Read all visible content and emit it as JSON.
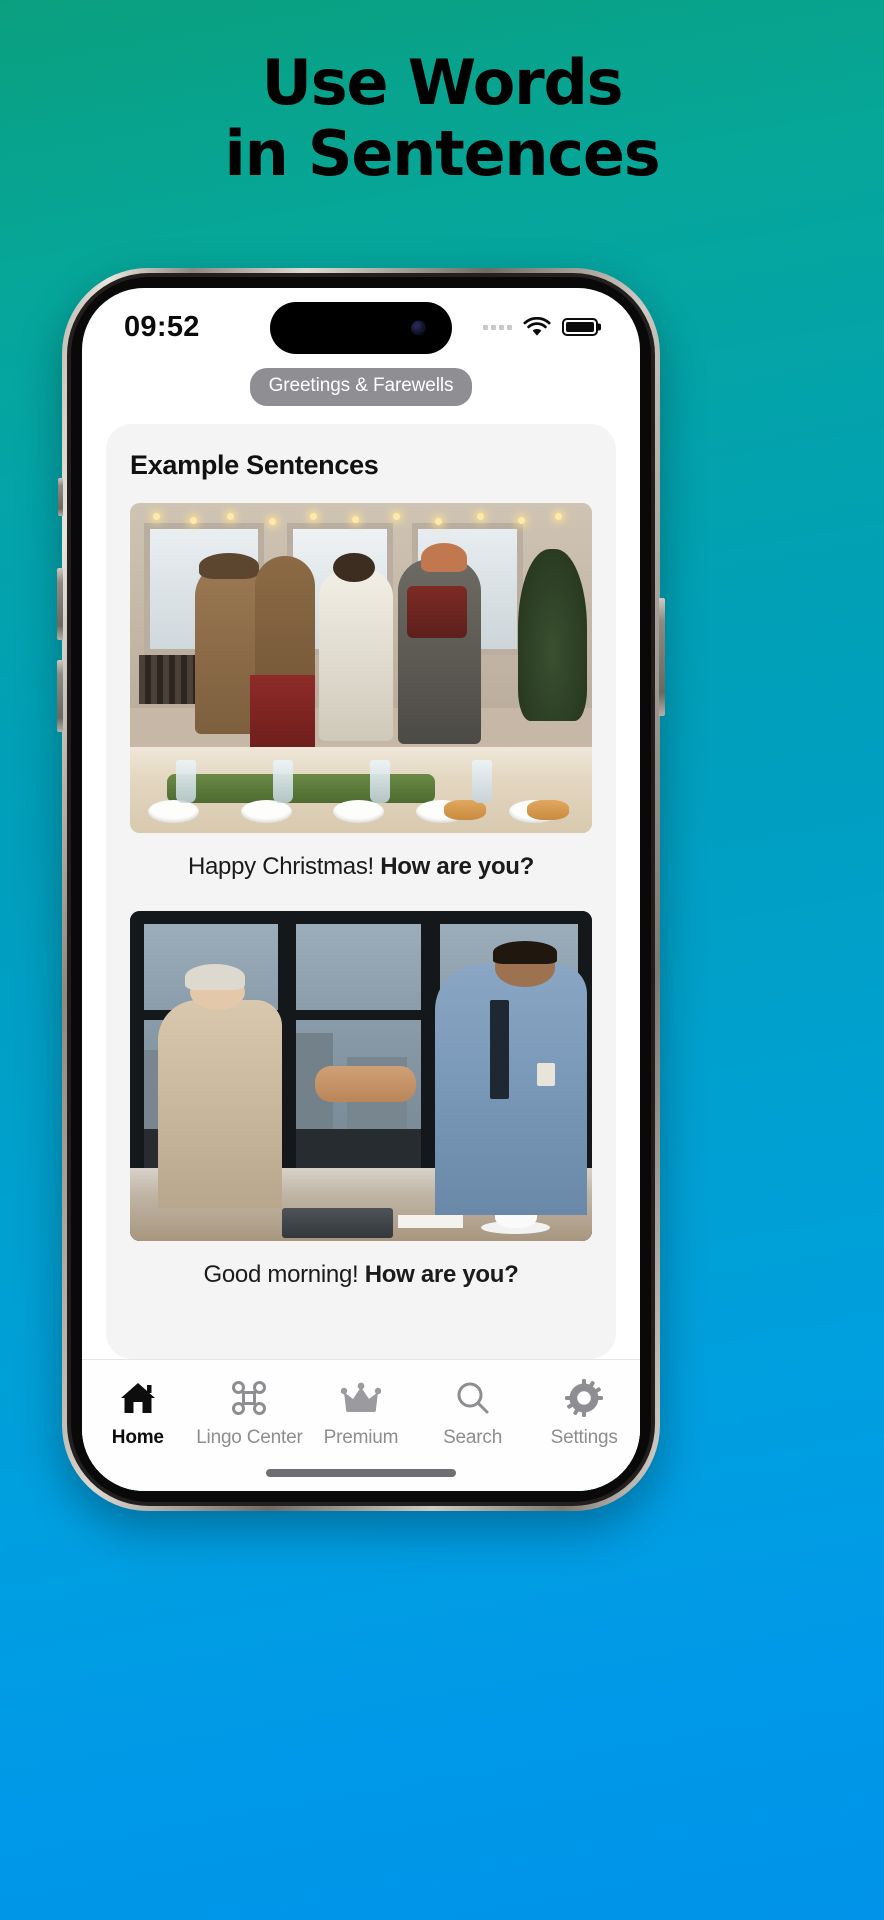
{
  "poster": {
    "headline_line1": "Use Words",
    "headline_line2": "in Sentences",
    "bg_top_color": "#0aa07f",
    "bg_bottom_color": "#0093e9",
    "headline_color": "#000000"
  },
  "status_bar": {
    "time": "09:52",
    "signal_icon": "signal-dots-icon",
    "wifi_icon": "wifi-icon",
    "battery_icon": "battery-full-icon"
  },
  "app": {
    "topic_pill": {
      "label": "Greetings & Farewells",
      "bg_color": "#8e8e93",
      "text_color": "#ffffff"
    },
    "card": {
      "title": "Example Sentences",
      "bg_color": "#f4f4f5",
      "sentences": [
        {
          "image_name": "christmas-gathering-photo",
          "plain_text": "Happy Christmas! ",
          "bold_text": "How are you?"
        },
        {
          "image_name": "office-handshake-photo",
          "plain_text": "Good morning! ",
          "bold_text": "How are you?"
        }
      ]
    },
    "tabs": [
      {
        "label": "Home",
        "icon": "home-icon",
        "active": true
      },
      {
        "label": "Lingo Center",
        "icon": "command-icon",
        "active": false
      },
      {
        "label": "Premium",
        "icon": "crown-icon",
        "active": false
      },
      {
        "label": "Search",
        "icon": "search-icon",
        "active": false
      },
      {
        "label": "Settings",
        "icon": "gear-icon",
        "active": false
      }
    ]
  }
}
